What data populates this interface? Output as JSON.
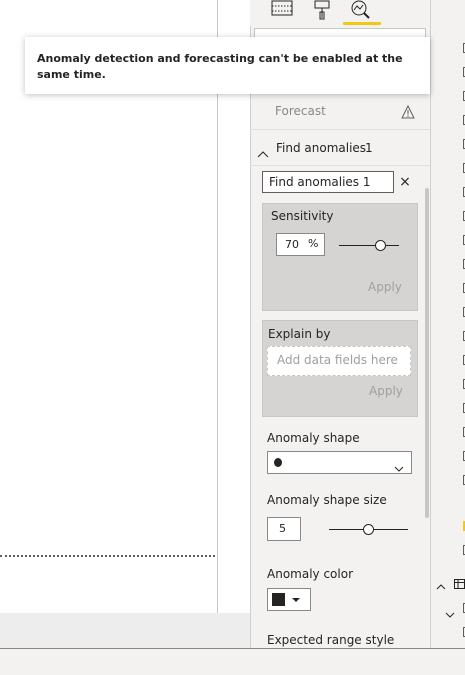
{
  "tooltip": {
    "text": "Anomaly detection and forecasting can't be enabled at the same time."
  },
  "pane": {
    "tools": [
      "table-icon",
      "paint-roller-icon",
      "analytics-magnifier-icon"
    ],
    "forecast": {
      "label": "Forecast",
      "warning_icon": "warning-icon"
    },
    "find_anomalies": {
      "header_label": "Find anomalies",
      "count": "1",
      "name_value": "Find anomalies 1",
      "close_icon": "×",
      "sensitivity": {
        "label": "Sensitivity",
        "value": "70",
        "unit": "%",
        "slider_fraction": 0.7,
        "apply": "Apply"
      },
      "explain_by": {
        "label": "Explain by",
        "placeholder": "Add data fields here",
        "apply": "Apply"
      },
      "anomaly_shape": {
        "label": "Anomaly shape",
        "value": "●"
      },
      "anomaly_shape_size": {
        "label": "Anomaly shape size",
        "value": "5"
      },
      "anomaly_color": {
        "label": "Anomaly color",
        "value": "#252423"
      },
      "expected_range_style": {
        "label": "Expected range style"
      }
    }
  },
  "colors": {
    "accent": "#f2c811",
    "pane_bg": "#f3f2f1",
    "card_bg": "#d6d4d2",
    "text": "#252423",
    "muted": "#a19f9d"
  }
}
